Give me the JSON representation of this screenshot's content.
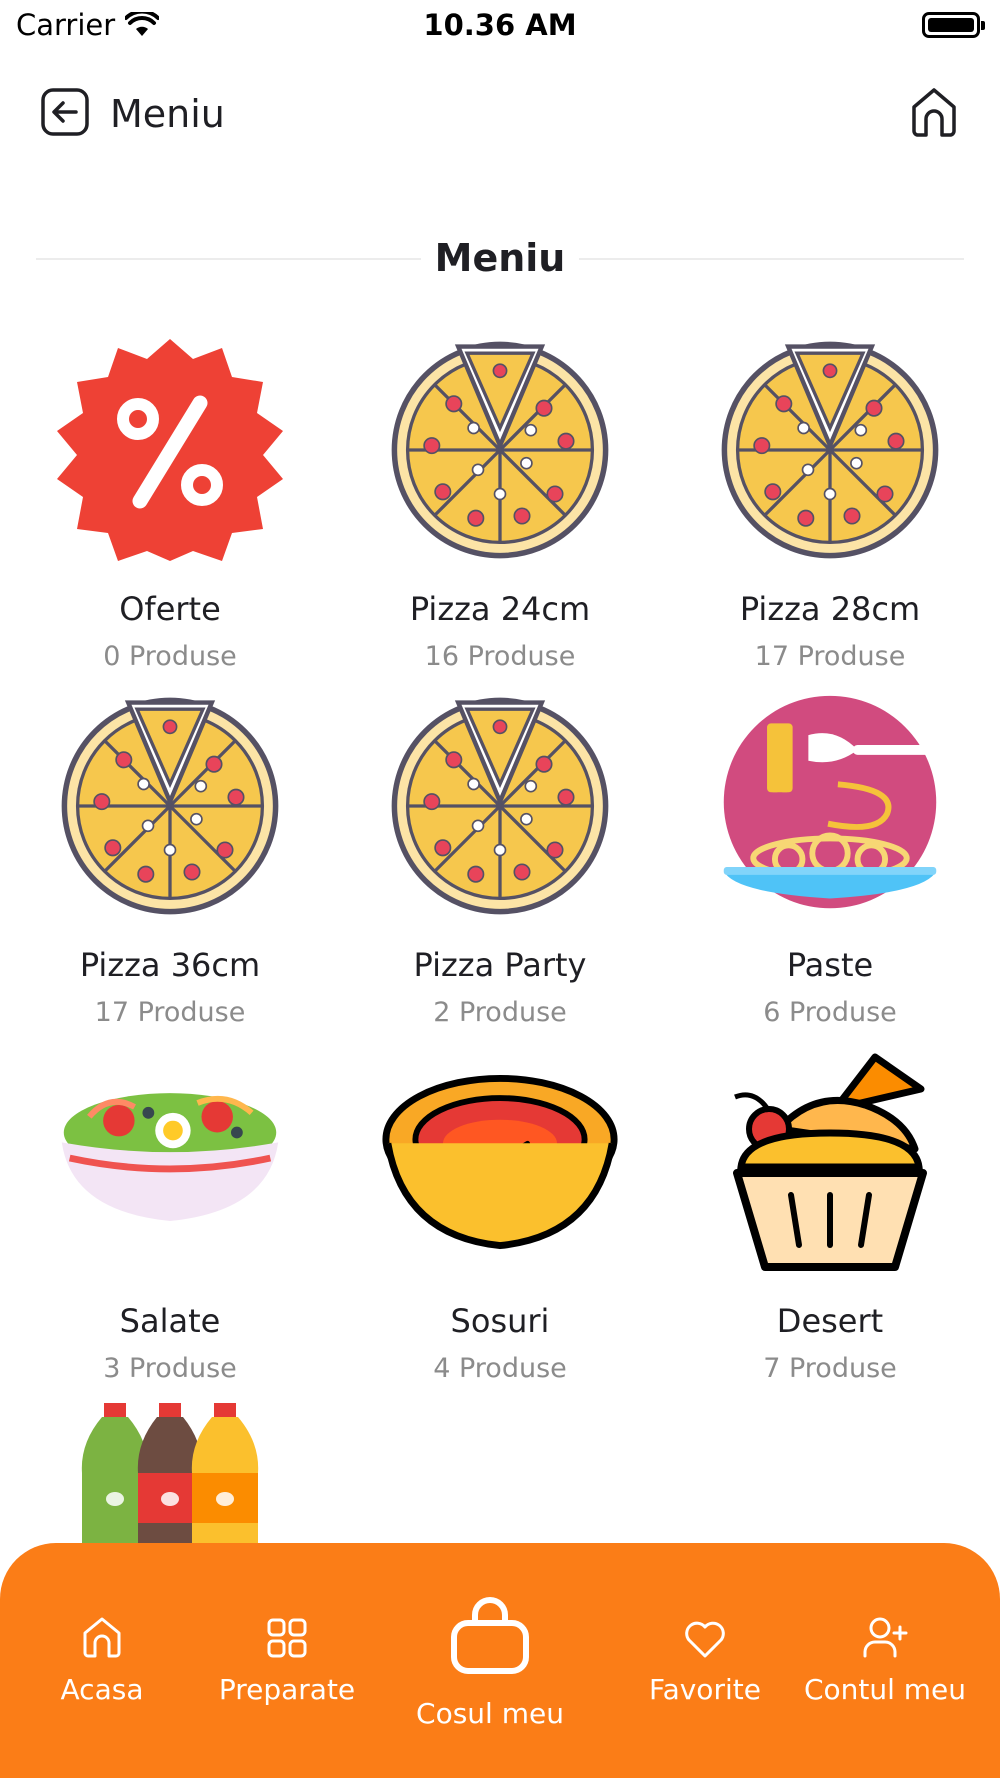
{
  "status_bar": {
    "carrier": "Carrier",
    "time": "10.36 AM"
  },
  "header": {
    "title": "Meniu",
    "back_icon": "arrow-left-square-icon",
    "home_icon": "home-icon"
  },
  "section": {
    "title": "Meniu"
  },
  "categories": [
    {
      "name": "Oferte",
      "count": "0 Produse",
      "icon": "discount-badge-icon"
    },
    {
      "name": "Pizza 24cm",
      "count": "16 Produse",
      "icon": "pizza-icon"
    },
    {
      "name": "Pizza 28cm",
      "count": "17 Produse",
      "icon": "pizza-icon"
    },
    {
      "name": "Pizza 36cm",
      "count": "17 Produse",
      "icon": "pizza-icon"
    },
    {
      "name": "Pizza Party",
      "count": "2 Produse",
      "icon": "pizza-icon"
    },
    {
      "name": "Paste",
      "count": "6 Produse",
      "icon": "pasta-icon"
    },
    {
      "name": "Salate",
      "count": "3 Produse",
      "icon": "salad-icon"
    },
    {
      "name": "Sosuri",
      "count": "4 Produse",
      "icon": "sauce-bowl-icon"
    },
    {
      "name": "Desert",
      "count": "7 Produse",
      "icon": "dessert-icon"
    },
    {
      "name": "",
      "count": "",
      "icon": "bottles-icon"
    }
  ],
  "bottom_nav": {
    "background": "#fb7d17",
    "items": [
      {
        "label": "Acasa",
        "icon": "home-icon"
      },
      {
        "label": "Preparate",
        "icon": "grid-icon"
      },
      {
        "label": "Cosul meu",
        "icon": "shopping-bag-icon"
      },
      {
        "label": "Favorite",
        "icon": "heart-icon"
      },
      {
        "label": "Contul meu",
        "icon": "user-add-icon"
      }
    ]
  }
}
